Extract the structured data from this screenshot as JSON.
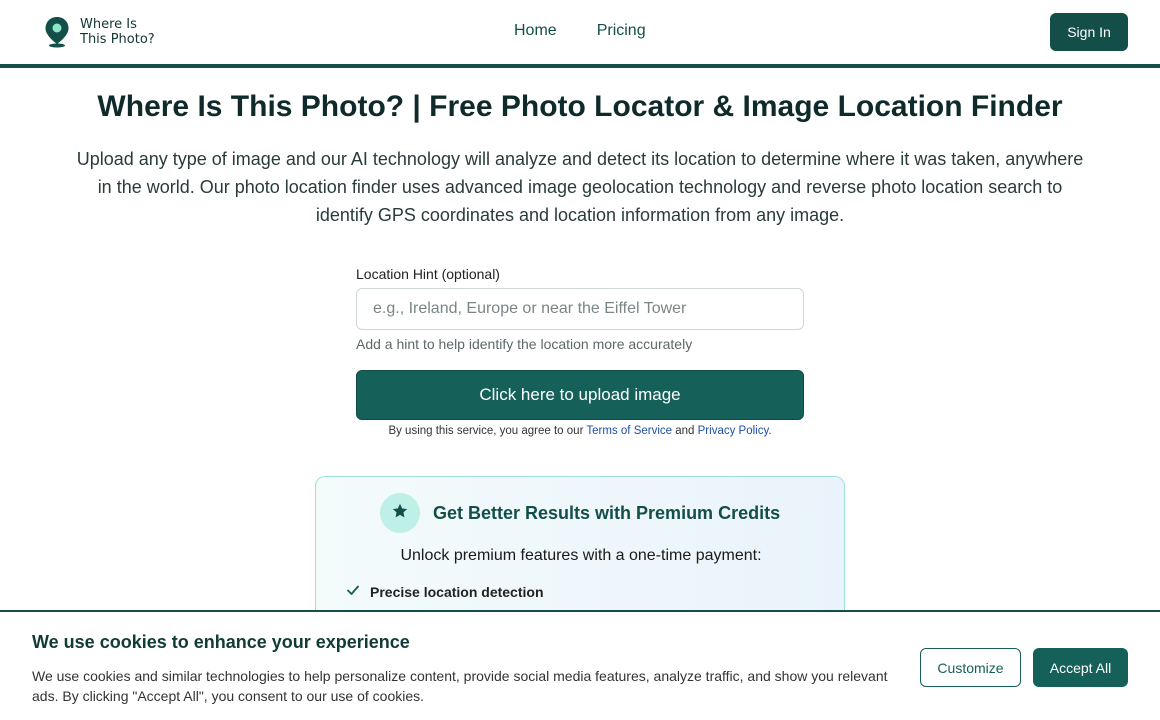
{
  "header": {
    "logo_line1": "Where Is",
    "logo_line2": "This Photo?",
    "logo_icon": "map-pin-icon",
    "nav": [
      {
        "label": "Home"
      },
      {
        "label": "Pricing"
      }
    ],
    "signin_label": "Sign In"
  },
  "hero": {
    "title": "Where Is This Photo? | Free Photo Locator & Image Location Finder",
    "description": "Upload any type of image and our AI technology will analyze and detect its location to determine where it was taken, anywhere in the world. Our photo location finder uses advanced image geolocation technology and reverse photo location search to identify GPS coordinates and location information from any image."
  },
  "form": {
    "hint_label": "Location Hint (optional)",
    "hint_placeholder": "e.g., Ireland, Europe or near the Eiffel Tower",
    "hint_value": "",
    "hint_help": "Add a hint to help identify the location more accurately",
    "upload_label": "Click here to upload image",
    "agree_prefix": "By using this service, you agree to our",
    "terms_label": "Terms of Service",
    "agree_and": "and",
    "privacy_label": "Privacy Policy",
    "agree_suffix": "."
  },
  "premium": {
    "icon": "star-icon",
    "title": "Get Better Results with Premium Credits",
    "subtitle": "Unlock premium features with a one-time payment:",
    "features": [
      {
        "icon": "check-icon",
        "label": "Precise location detection"
      }
    ]
  },
  "cookie": {
    "title": "We use cookies to enhance your experience",
    "text": "We use cookies and similar technologies to help personalize content, provide social media features, analyze traffic, and show you relevant ads. By clicking \"Accept All\", you consent to our use of cookies.",
    "customize_label": "Customize",
    "accept_label": "Accept All"
  },
  "colors": {
    "brand": "#134e48",
    "button": "#156058",
    "accent_light": "#bff0e6",
    "link": "#1d4fa8"
  }
}
